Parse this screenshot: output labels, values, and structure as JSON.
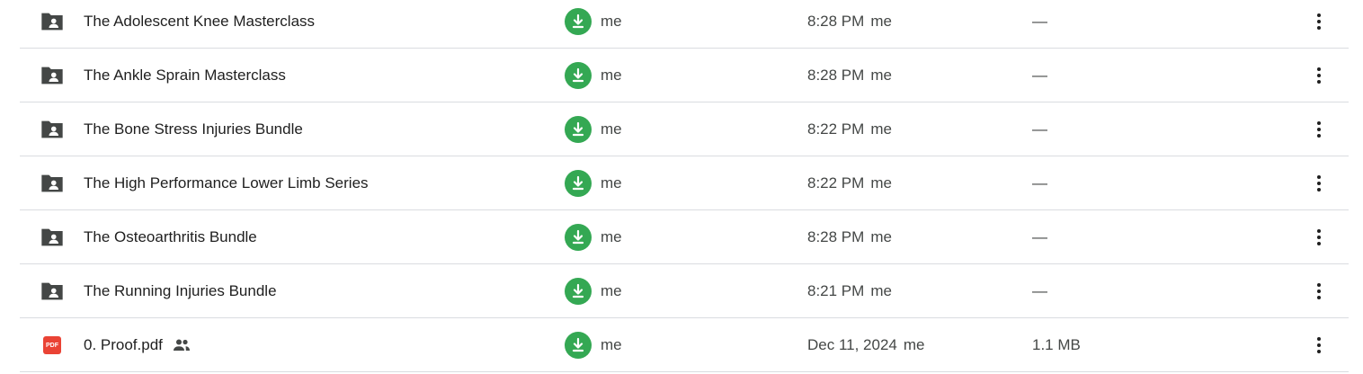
{
  "colors": {
    "folder_icon": "#444746",
    "pdf_icon": "#ea4335",
    "owner_avatar": "#34a853",
    "divider": "#dadce0"
  },
  "rows": [
    {
      "name": "The Adolescent Knee Masterclass",
      "type_icon": "shared-folder-icon",
      "owner": "me",
      "modified_date": "8:28 PM",
      "modified_by": "me",
      "size": "—",
      "shared": false
    },
    {
      "name": "The Ankle Sprain Masterclass",
      "type_icon": "shared-folder-icon",
      "owner": "me",
      "modified_date": "8:28 PM",
      "modified_by": "me",
      "size": "—",
      "shared": false
    },
    {
      "name": "The Bone Stress Injuries Bundle",
      "type_icon": "shared-folder-icon",
      "owner": "me",
      "modified_date": "8:22 PM",
      "modified_by": "me",
      "size": "—",
      "shared": false
    },
    {
      "name": "The High Performance Lower Limb Series",
      "type_icon": "shared-folder-icon",
      "owner": "me",
      "modified_date": "8:22 PM",
      "modified_by": "me",
      "size": "—",
      "shared": false
    },
    {
      "name": "The Osteoarthritis Bundle",
      "type_icon": "shared-folder-icon",
      "owner": "me",
      "modified_date": "8:28 PM",
      "modified_by": "me",
      "size": "—",
      "shared": false
    },
    {
      "name": "The Running Injuries Bundle",
      "type_icon": "shared-folder-icon",
      "owner": "me",
      "modified_date": "8:21 PM",
      "modified_by": "me",
      "size": "—",
      "shared": false
    },
    {
      "name": "0. Proof.pdf",
      "type_icon": "pdf-icon",
      "pdf_label": "PDF",
      "owner": "me",
      "modified_date": "Dec 11, 2024",
      "modified_by": "me",
      "size": "1.1 MB",
      "shared": true
    }
  ]
}
